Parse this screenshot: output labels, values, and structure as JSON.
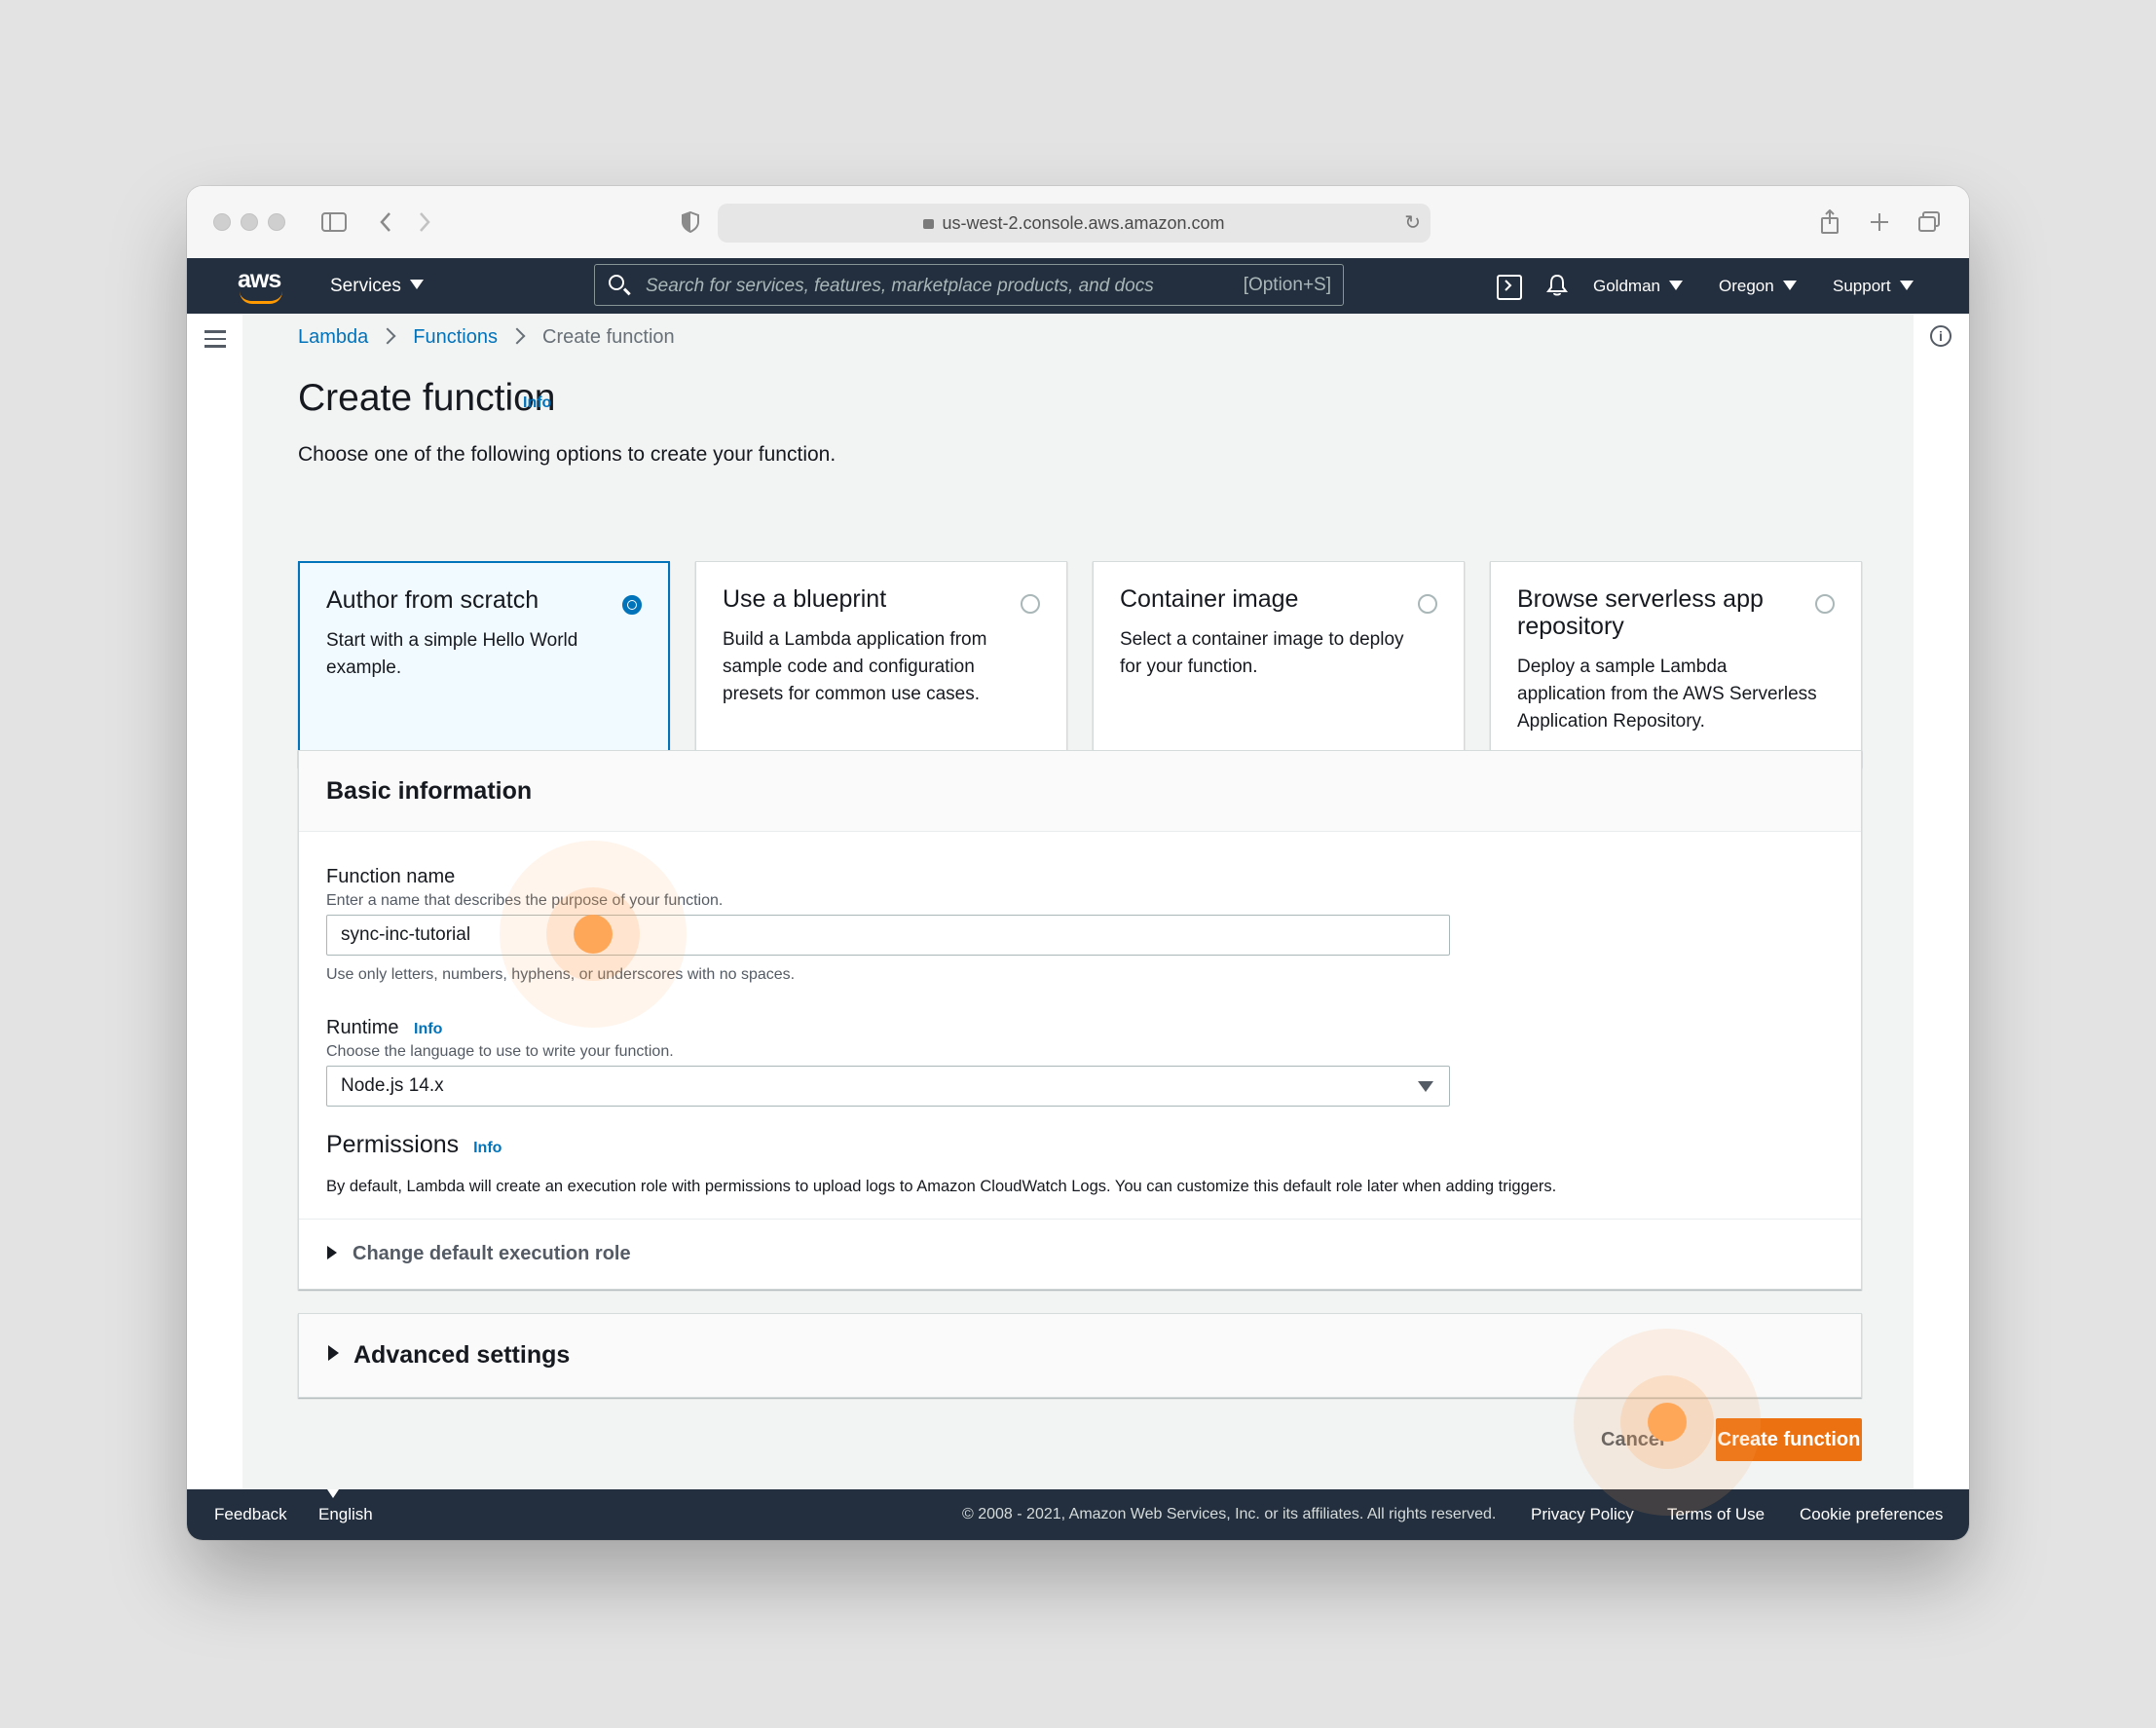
{
  "browser": {
    "url": "us-west-2.console.aws.amazon.com"
  },
  "navbar": {
    "logo": "aws",
    "services_label": "Services",
    "search_placeholder": "Search for services, features, marketplace products, and docs",
    "search_shortcut": "[Option+S]",
    "account_label": "Goldman",
    "region_label": "Oregon",
    "support_label": "Support"
  },
  "breadcrumb": {
    "items": [
      "Lambda",
      "Functions",
      "Create function"
    ]
  },
  "page": {
    "title": "Create function",
    "title_info": "Info",
    "subtitle": "Choose one of the following options to create your function."
  },
  "options": [
    {
      "title": "Author from scratch",
      "description": "Start with a simple Hello World example.",
      "selected": true
    },
    {
      "title": "Use a blueprint",
      "description": "Build a Lambda application from sample code and configuration presets for common use cases.",
      "selected": false
    },
    {
      "title": "Container image",
      "description": "Select a container image to deploy for your function.",
      "selected": false
    },
    {
      "title": "Browse serverless app repository",
      "description": "Deploy a sample Lambda application from the AWS Serverless Application Repository.",
      "selected": false
    }
  ],
  "basic_info": {
    "title": "Basic information",
    "function_name_label": "Function name",
    "function_name_desc": "Enter a name that describes the purpose of your function.",
    "function_name_value": "sync-inc-tutorial",
    "function_name_hint": "Use only letters, numbers, hyphens, or underscores with no spaces.",
    "runtime_label": "Runtime",
    "runtime_info": "Info",
    "runtime_desc": "Choose the language to use to write your function.",
    "runtime_value": "Node.js 14.x",
    "permissions_label": "Permissions",
    "permissions_info": "Info",
    "permissions_desc": "By default, Lambda will create an execution role with permissions to upload logs to Amazon CloudWatch Logs. You can customize this default role later when adding triggers.",
    "change_role_label": "Change default execution role"
  },
  "advanced": {
    "label": "Advanced settings"
  },
  "actions": {
    "cancel_label": "Cancel",
    "create_label": "Create function"
  },
  "footer": {
    "feedback": "Feedback",
    "language": "English (US)",
    "copyright": "© 2008 - 2021, Amazon Web Services, Inc. or its affiliates. All rights reserved.",
    "privacy": "Privacy Policy",
    "terms": "Terms of Use",
    "cookies": "Cookie preferences"
  },
  "colors": {
    "nav_bg": "#232f3e",
    "link": "#0073bb",
    "primary_button": "#ec7211",
    "click_highlight": "#ff9f4a"
  }
}
